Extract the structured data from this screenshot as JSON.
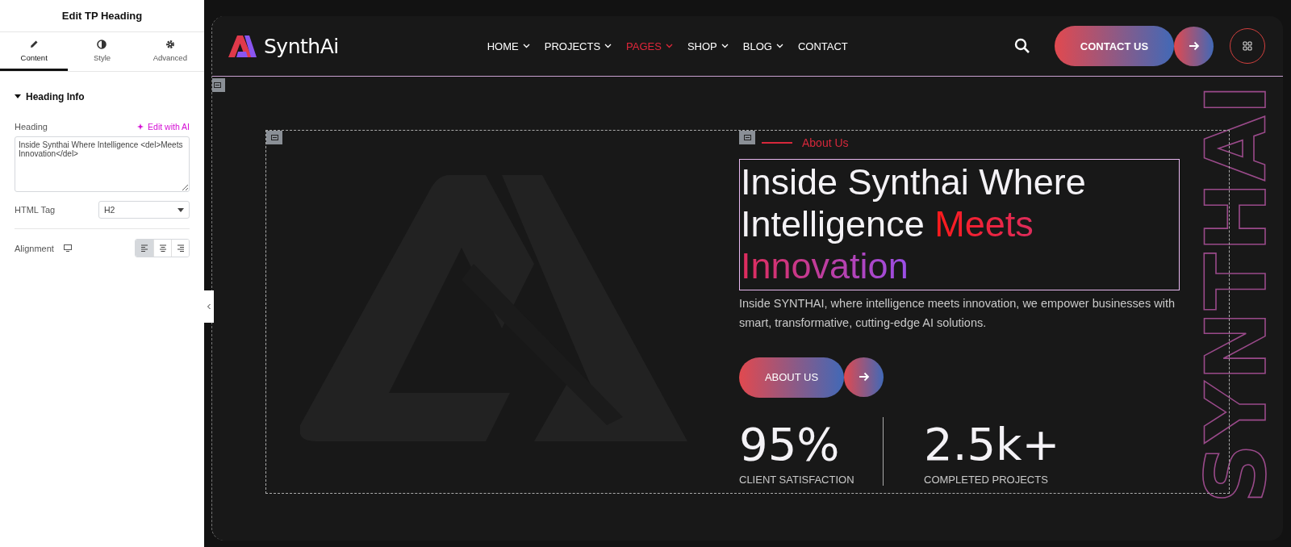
{
  "editor": {
    "title": "Edit TP Heading",
    "tabs": [
      {
        "label": "Content",
        "kind": "pencil",
        "selected": true
      },
      {
        "label": "Style",
        "kind": "contrast",
        "selected": false
      },
      {
        "label": "Advanced",
        "kind": "gear",
        "selected": false
      }
    ],
    "section": {
      "title": "Heading Info",
      "expanded": true
    },
    "heading_label": "Heading",
    "ai_link": "Edit with AI",
    "heading_value": "Inside Synthai Where Intelligence <del>Meets Innovation</del>",
    "html_tag_label": "HTML Tag",
    "html_tag_value": "H2",
    "alignment_label": "Alignment",
    "alignment_options": [
      {
        "kind": "left",
        "selected": true
      },
      {
        "kind": "center",
        "selected": false
      },
      {
        "kind": "right",
        "selected": false
      }
    ]
  },
  "site": {
    "logo_text": "SynthAi",
    "nav": [
      {
        "label": "HOME",
        "has_menu": true,
        "selected": false
      },
      {
        "label": "PROJECTS",
        "has_menu": true,
        "selected": false
      },
      {
        "label": "PAGES",
        "has_menu": true,
        "selected": true
      },
      {
        "label": "SHOP",
        "has_menu": true,
        "selected": false
      },
      {
        "label": "BLOG",
        "has_menu": true,
        "selected": false
      },
      {
        "label": "CONTACT",
        "has_menu": false,
        "selected": false
      }
    ],
    "contact_button": "CONTACT US",
    "subtitle": "About Us",
    "heading": [
      {
        "text": "Inside Synthai Where Intelligence ",
        "kind": "plain"
      },
      {
        "text": "Meets Innovation",
        "kind": "gradient"
      }
    ],
    "description": "Inside SYNTHAI, where intelligence meets innovation, we empower businesses with smart, transformative, cutting-edge AI solutions.",
    "about_button": "ABOUT US",
    "stats": [
      {
        "value": "95%",
        "label": "CLIENT SATISFACTION"
      },
      {
        "value": "2.5k+",
        "label": "COMPLETED PROJECTS"
      }
    ],
    "vertical_text": "SYNTHAI"
  }
}
